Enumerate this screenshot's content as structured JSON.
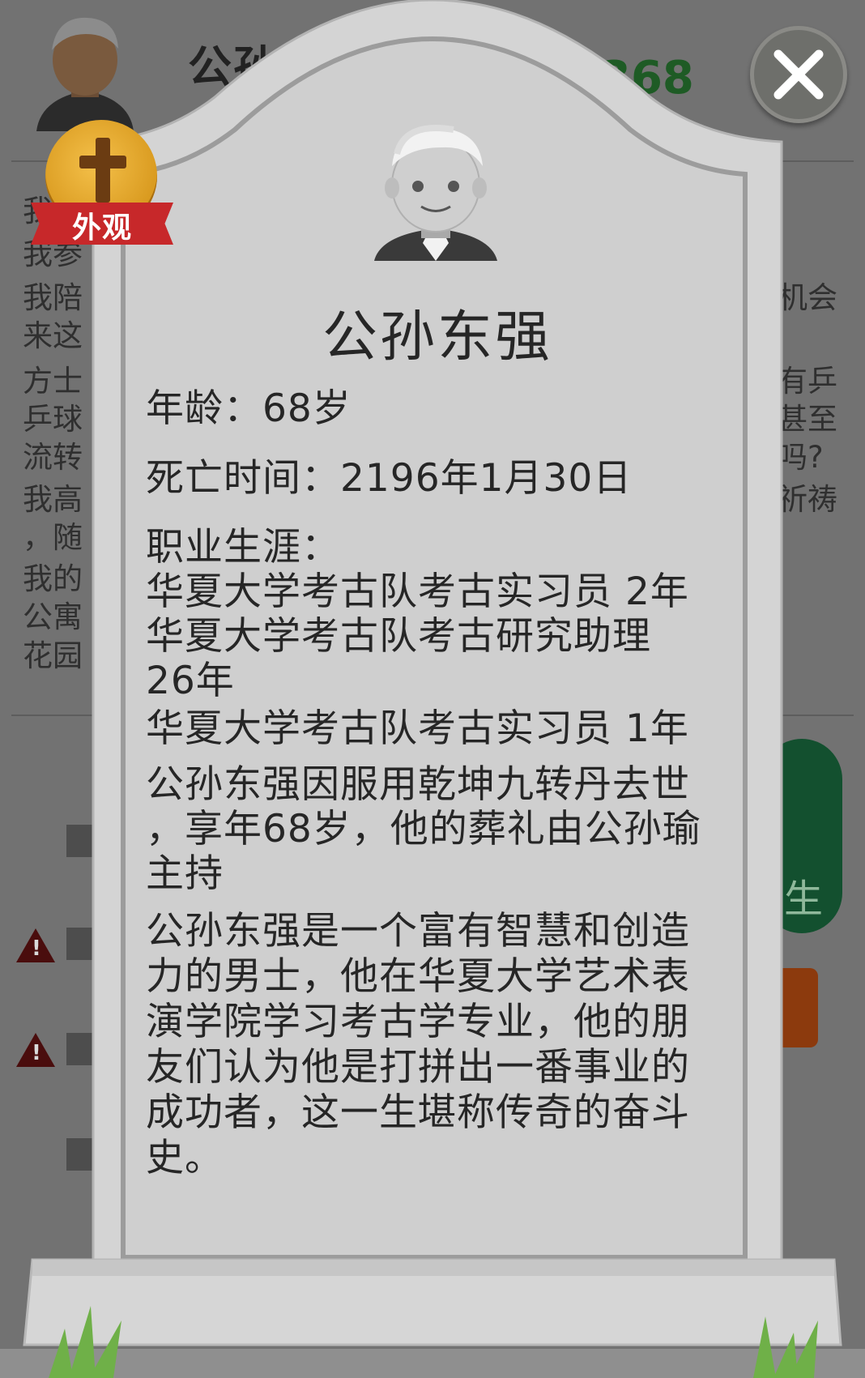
{
  "background": {
    "character_name": "公孙东",
    "money": "368",
    "log_lines": [
      {
        "left": "我",
        "right": ""
      },
      {
        "left": "我参",
        "right": ""
      },
      {
        "left": "我陪",
        "right": "机会"
      },
      {
        "left": "来这",
        "right": ""
      },
      {
        "left": "方士",
        "right": "有乒"
      },
      {
        "left": "乒球",
        "right": "甚至"
      },
      {
        "left": "流转",
        "right": "吗?"
      },
      {
        "left": "我高",
        "right": "祈祷"
      },
      {
        "left": "，随",
        "right": ""
      },
      {
        "left": "我的",
        "right": ""
      },
      {
        "left": "公寓",
        "right": ""
      },
      {
        "left": "花园",
        "right": ""
      }
    ],
    "side_button_label": "生"
  },
  "badge": {
    "label": "外观"
  },
  "tombstone": {
    "name": "公孙东强",
    "age_line": "年龄：68岁",
    "death_time_line": "死亡时间：2196年1月30日",
    "career_heading": "职业生涯：",
    "career_lines": [
      "华夏大学考古队考古实习员 2年",
      "华夏大学考古队考古研究助理",
      "26年",
      "华夏大学考古队考古实习员 1年"
    ],
    "death_lines": [
      "公孙东强因服用乾坤九转丹去世",
      "，享年68岁，他的葬礼由公孙瑜",
      "主持"
    ],
    "bio_lines": [
      "公孙东强是一个富有智慧和创造",
      "力的男士，他在华夏大学艺术表",
      "演学院学习考古学专业，他的朋",
      "友们认为他是打拼出一番事业的",
      "成功者，这一生堪称传奇的奋斗",
      "史。"
    ]
  },
  "icons": {
    "close": "close-icon",
    "badge": "cross-icon",
    "portrait": "elder-portrait-icon",
    "warning": "warning-icon"
  },
  "colors": {
    "stone": "#d4d4d4",
    "stone_panel": "#cfcfcf",
    "text": "#262626",
    "ribbon": "#c7282a",
    "coin": "#e3a52c",
    "money_green": "#1e5b25"
  }
}
